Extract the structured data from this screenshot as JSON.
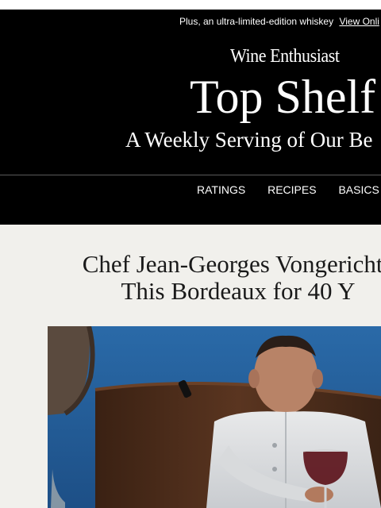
{
  "preheader": {
    "text": "Plus, an ultra-limited-edition whiskey",
    "view_link": "View Onli"
  },
  "brand": {
    "logo_text": "Wine Enthusiast"
  },
  "newsletter": {
    "title": "Top Shelf",
    "subtitle": "A Weekly Serving of Our Be"
  },
  "nav": {
    "items": [
      "RATINGS",
      "RECIPES",
      "BASICS"
    ]
  },
  "article": {
    "title_line1": "Chef Jean-Georges Vongerichte",
    "title_line2": "This Bordeaux for 40 Y",
    "image_alt": "Chef in white jacket holding a glass of red wine"
  },
  "colors": {
    "header_bg": "#000000",
    "page_bg": "#f1f0ec",
    "text_dark": "#1a1a1a"
  }
}
